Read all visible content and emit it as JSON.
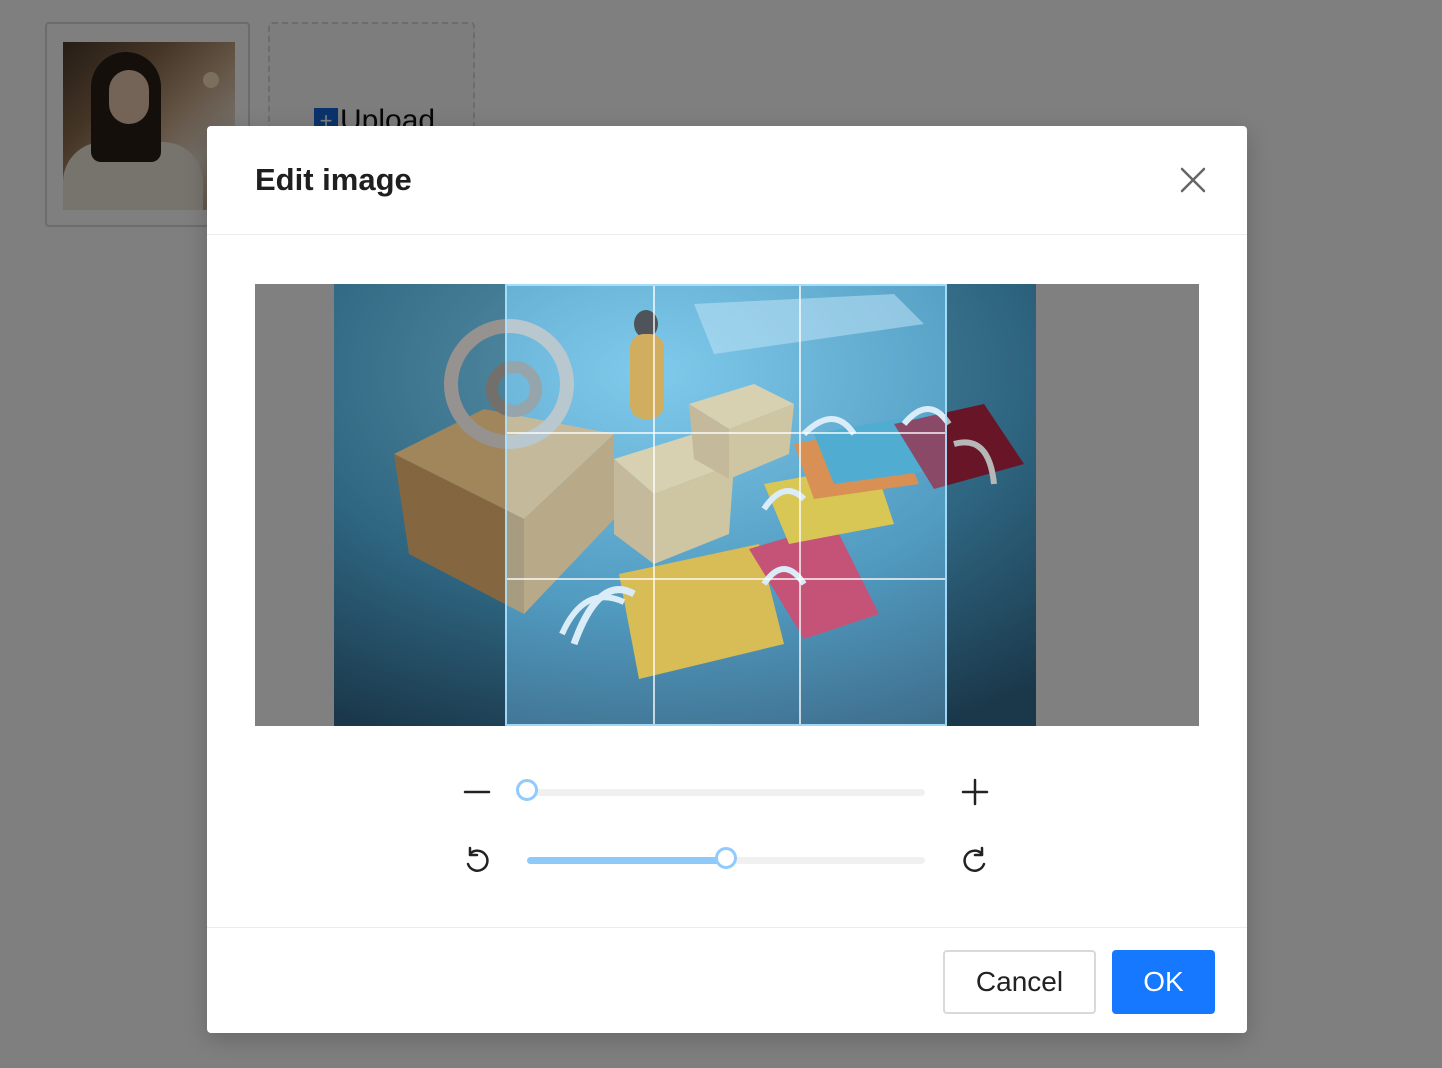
{
  "upload_list": {
    "items": [
      {
        "type": "image",
        "alt": "woman with coffee cup"
      }
    ],
    "upload_label": "Upload"
  },
  "modal": {
    "title": "Edit image",
    "zoom": {
      "decrease_icon": "minus-icon",
      "increase_icon": "plus-icon",
      "value": 0
    },
    "rotate": {
      "left_icon": "rotate-left-icon",
      "right_icon": "rotate-right-icon",
      "value": 0.5
    },
    "cancel_label": "Cancel",
    "ok_label": "OK"
  },
  "colors": {
    "primary": "#1677ff",
    "slider_accent": "#91caff"
  }
}
